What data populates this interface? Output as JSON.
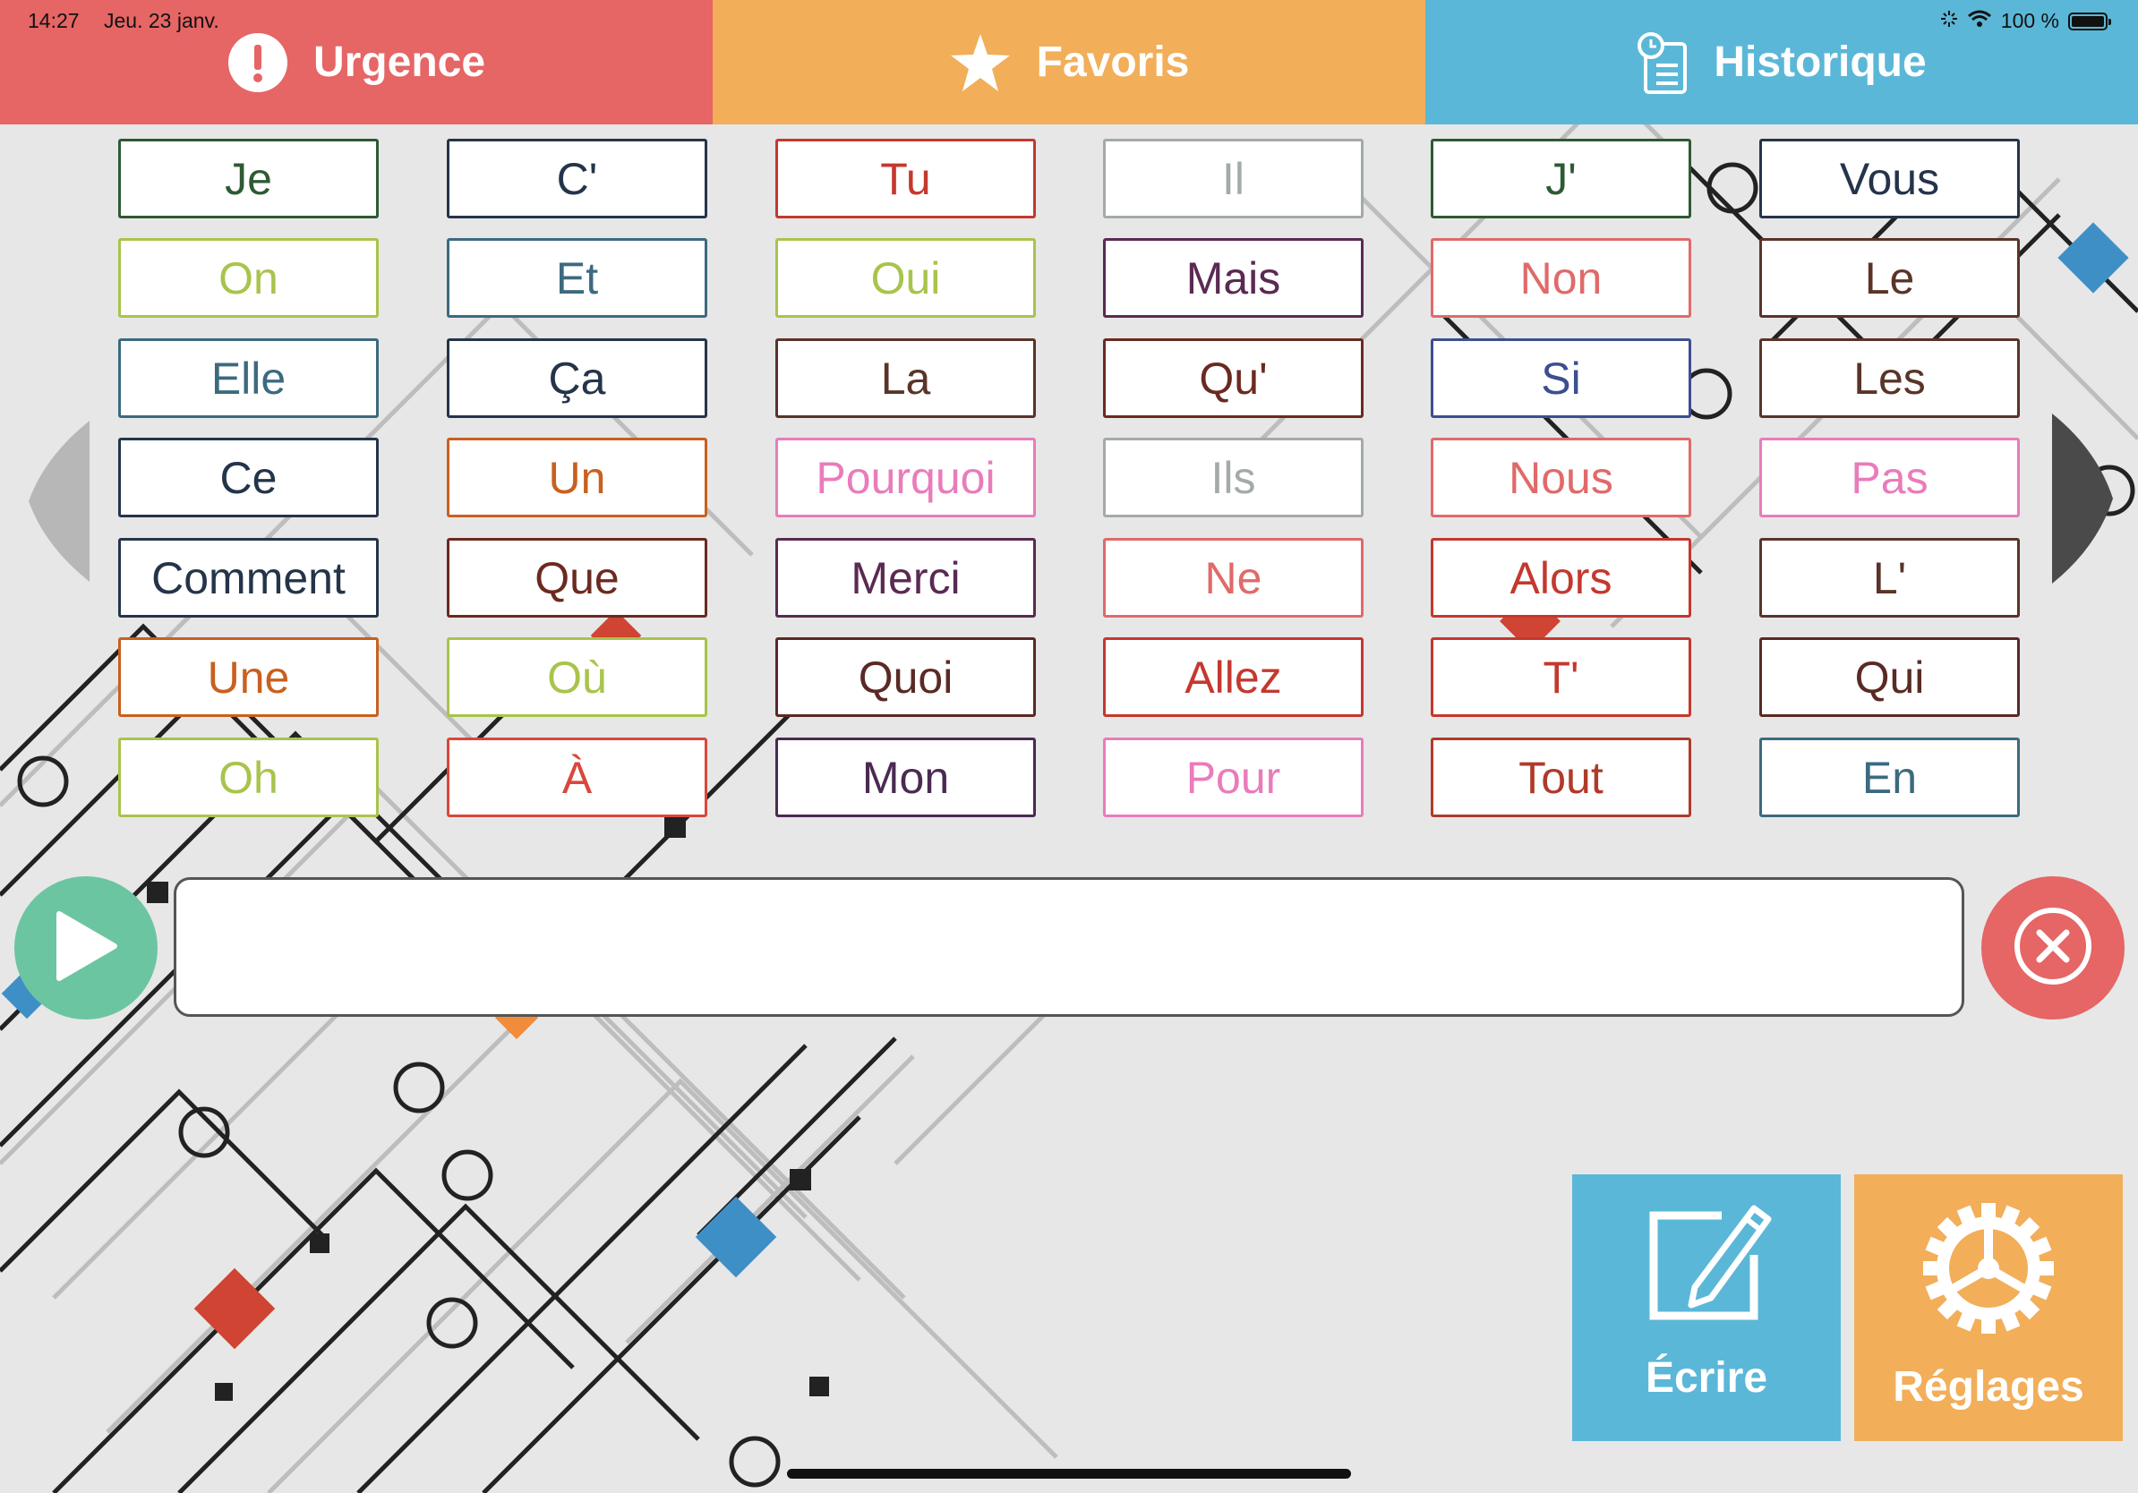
{
  "status_bar": {
    "time": "14:27",
    "date": "Jeu. 23 janv.",
    "battery": "100 %"
  },
  "tabs": [
    {
      "label": "Urgence",
      "icon": "exclamation-icon",
      "color": "#e66565"
    },
    {
      "label": "Favoris",
      "icon": "star-icon",
      "color": "#f2ae59"
    },
    {
      "label": "Historique",
      "icon": "history-icon",
      "color": "#5bb7d7"
    }
  ],
  "words": [
    [
      {
        "text": "Je",
        "color": "#2e5a33"
      },
      {
        "text": "On",
        "color": "#a8c44b"
      },
      {
        "text": "Elle",
        "color": "#3c6a7f"
      },
      {
        "text": "Ce",
        "color": "#24344a"
      },
      {
        "text": "Comment",
        "color": "#24344a"
      },
      {
        "text": "Une",
        "color": "#c8601f"
      },
      {
        "text": "Oh",
        "color": "#a8c44b"
      }
    ],
    [
      {
        "text": "C'",
        "color": "#24344a"
      },
      {
        "text": "Et",
        "color": "#3c6a7f"
      },
      {
        "text": "Ça",
        "color": "#24344a"
      },
      {
        "text": "Un",
        "color": "#c8601f"
      },
      {
        "text": "Que",
        "color": "#6b2a20"
      },
      {
        "text": "Où",
        "color": "#a8c44b"
      },
      {
        "text": "À",
        "color": "#d9473c"
      }
    ],
    [
      {
        "text": "Tu",
        "color": "#c4382e"
      },
      {
        "text": "Oui",
        "color": "#a8c44b"
      },
      {
        "text": "La",
        "color": "#5a3428"
      },
      {
        "text": "Pourquoi",
        "color": "#e97cbb"
      },
      {
        "text": "Merci",
        "color": "#5a2a52"
      },
      {
        "text": "Quoi",
        "color": "#5a2a24"
      },
      {
        "text": "Mon",
        "color": "#4a2a52"
      }
    ],
    [
      {
        "text": "Il",
        "color": "#a3aaa8"
      },
      {
        "text": "Mais",
        "color": "#5a2a52"
      },
      {
        "text": "Qu'",
        "color": "#6b2a20"
      },
      {
        "text": "Ils",
        "color": "#a3aaa8"
      },
      {
        "text": "Ne",
        "color": "#e06a6a"
      },
      {
        "text": "Allez",
        "color": "#c4382e"
      },
      {
        "text": "Pour",
        "color": "#e97cbb"
      }
    ],
    [
      {
        "text": "J'",
        "color": "#2e5a33"
      },
      {
        "text": "Non",
        "color": "#e06a6a"
      },
      {
        "text": "Si",
        "color": "#3c4f8f"
      },
      {
        "text": "Nous",
        "color": "#e06a6a"
      },
      {
        "text": "Alors",
        "color": "#c4382e"
      },
      {
        "text": "T'",
        "color": "#c4382e"
      },
      {
        "text": "Tout",
        "color": "#b03a2a"
      }
    ],
    [
      {
        "text": "Vous",
        "color": "#24344a"
      },
      {
        "text": "Le",
        "color": "#5a3428"
      },
      {
        "text": "Les",
        "color": "#5a3428"
      },
      {
        "text": "Pas",
        "color": "#e97cbb"
      },
      {
        "text": "L'",
        "color": "#5a3428"
      },
      {
        "text": "Qui",
        "color": "#5a2a24"
      },
      {
        "text": "En",
        "color": "#3c6a7f"
      }
    ]
  ],
  "sentence": {
    "text": "",
    "play_icon": "play-icon",
    "clear_icon": "close-icon"
  },
  "navigation": {
    "prev_icon": "chevron-left-icon",
    "next_icon": "chevron-right-icon"
  },
  "actions": [
    {
      "label": "Écrire",
      "icon": "edit-icon",
      "color": "#5bb7d7"
    },
    {
      "label": "Réglages",
      "icon": "gear-icon",
      "color": "#f2ae59"
    }
  ]
}
